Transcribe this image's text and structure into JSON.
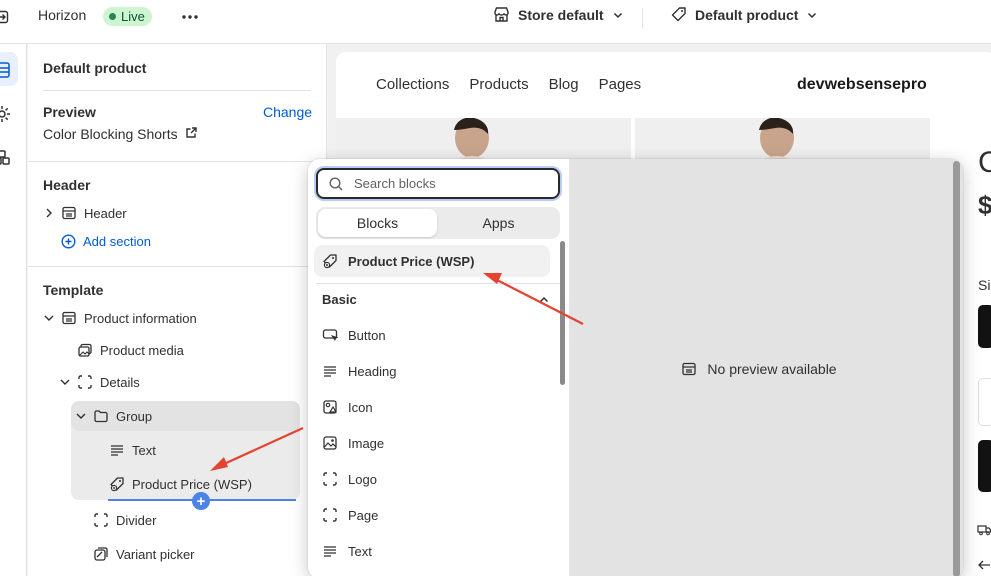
{
  "topbar": {
    "theme_name": "Horizon",
    "status_badge": "Live",
    "store_selector": "Store default",
    "template_selector": "Default product"
  },
  "sidebar": {
    "title": "Default product",
    "preview": {
      "heading": "Preview",
      "change_label": "Change",
      "product_name": "Color Blocking Shorts"
    },
    "header_section": {
      "heading": "Header",
      "item": "Header",
      "add_section": "Add section"
    },
    "template_section": {
      "heading": "Template",
      "items": [
        {
          "label": "Product information",
          "icon": "section-icon"
        },
        {
          "label": "Product media",
          "icon": "media-icon"
        },
        {
          "label": "Details",
          "icon": "block-icon"
        },
        {
          "label": "Group",
          "icon": "folder-icon"
        },
        {
          "label": "Text",
          "icon": "text-icon"
        },
        {
          "label": "Product Price (WSP)",
          "icon": "price-tag-icon"
        },
        {
          "label": "Divider",
          "icon": "block-icon"
        },
        {
          "label": "Variant picker",
          "icon": "variant-icon"
        }
      ]
    }
  },
  "preview_page": {
    "nav": [
      "Collections",
      "Products",
      "Blog",
      "Pages"
    ],
    "brand": "devwebsensepro",
    "peek": {
      "letter_c": "C",
      "dollar": "$",
      "si": "Si"
    }
  },
  "block_picker": {
    "search_placeholder": "Search blocks",
    "tabs": [
      "Blocks",
      "Apps"
    ],
    "active_tab": "Blocks",
    "featured_item": "Product Price (WSP)",
    "category": "Basic",
    "items": [
      {
        "label": "Button",
        "icon": "button-icon"
      },
      {
        "label": "Heading",
        "icon": "heading-icon"
      },
      {
        "label": "Icon",
        "icon": "shapes-icon"
      },
      {
        "label": "Image",
        "icon": "image-icon"
      },
      {
        "label": "Logo",
        "icon": "block-icon"
      },
      {
        "label": "Page",
        "icon": "block-icon"
      },
      {
        "label": "Text",
        "icon": "text-icon"
      }
    ],
    "preview_message": "No preview available"
  },
  "colors": {
    "accent_blue": "#005bd3",
    "live_green": "#29845a",
    "annotation_red": "#e5432f",
    "drop_indicator": "#4b84e6"
  }
}
